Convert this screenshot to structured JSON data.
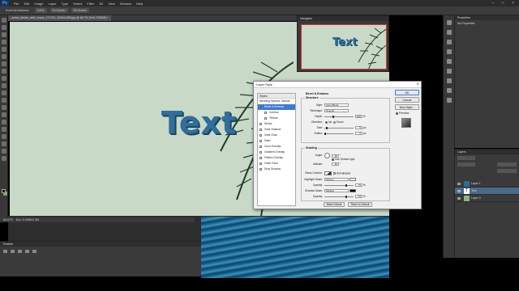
{
  "app": {
    "logo": "Ps"
  },
  "menu": [
    "File",
    "Edit",
    "Image",
    "Layer",
    "Type",
    "Select",
    "Filter",
    "3D",
    "View",
    "Window",
    "Help"
  ],
  "window_controls": "– □ ×",
  "options": {
    "scroll_all": "Scroll All Windows",
    "b1": "100%",
    "b2": "Fit Screen",
    "b3": "Fill Screen"
  },
  "doc_tab": "ocean_desire_wide_tropic_171742_1920x1080.jpg @ 66.7% (Text, RGB/8) *",
  "status": {
    "zoom": "66.67%",
    "doc": "Doc: 5.93M/11.3M"
  },
  "canvas_text": "Text",
  "navigator": {
    "title": "Navigator",
    "thumb_text": "Text"
  },
  "timeline": {
    "title": "Timeline"
  },
  "properties": {
    "title": "Properties",
    "subtitle": "No Properties"
  },
  "layers": {
    "title": "Layers",
    "rows": [
      {
        "name": "Layer 1"
      },
      {
        "name": "Text"
      },
      {
        "name": "Layer 0"
      }
    ]
  },
  "dialog": {
    "title": "Layer Style",
    "close": "×",
    "styles_header": "Styles",
    "blending_options": "Blending Options: Default",
    "style_items": [
      {
        "label": "Bevel & Emboss",
        "checked": true,
        "selected": true
      },
      {
        "label": "Contour",
        "checked": false,
        "sub": true
      },
      {
        "label": "Texture",
        "checked": false,
        "sub": true
      },
      {
        "label": "Stroke",
        "checked": false
      },
      {
        "label": "Inner Shadow",
        "checked": false
      },
      {
        "label": "Inner Glow",
        "checked": false
      },
      {
        "label": "Satin",
        "checked": false
      },
      {
        "label": "Color Overlay",
        "checked": false
      },
      {
        "label": "Gradient Overlay",
        "checked": false
      },
      {
        "label": "Pattern Overlay",
        "checked": false
      },
      {
        "label": "Outer Glow",
        "checked": false
      },
      {
        "label": "Drop Shadow",
        "checked": false
      }
    ],
    "section_title": "Bevel & Emboss",
    "structure": {
      "title": "Structure",
      "style_label": "Style:",
      "style_value": "Inner Bevel",
      "technique_label": "Technique:",
      "technique_value": "Smooth",
      "depth_label": "Depth:",
      "depth_value": "100",
      "depth_unit": "%",
      "direction_label": "Direction:",
      "dir_up": "Up",
      "dir_down": "Down",
      "size_label": "Size:",
      "size_value": "5",
      "size_unit": "px",
      "soften_label": "Soften:",
      "soften_value": "0",
      "soften_unit": "px"
    },
    "shading": {
      "title": "Shading",
      "angle_label": "Angle:",
      "angle_value": "30",
      "angle_unit": "°",
      "global_light": "Use Global Light",
      "altitude_label": "Altitude:",
      "altitude_value": "30",
      "altitude_unit": "°",
      "gloss_label": "Gloss Contour:",
      "anti_aliased": "Anti-aliased",
      "highlight_label": "Highlight Mode:",
      "highlight_value": "Screen",
      "opacity_label": "Opacity:",
      "highlight_opacity": "75",
      "pct": "%",
      "shadow_label": "Shadow Mode:",
      "shadow_value": "Multiply",
      "shadow_opacity": "75"
    },
    "make_default": "Make Default",
    "reset_default": "Reset to Default",
    "buttons": {
      "ok": "OK",
      "cancel": "Cancel",
      "new_style": "New Style...",
      "preview": "Preview"
    }
  }
}
